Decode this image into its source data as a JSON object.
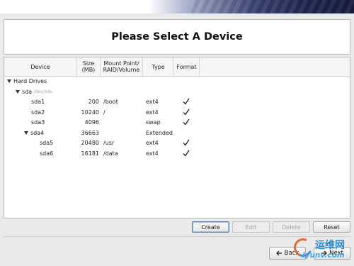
{
  "page": {
    "title": "Please Select A Device"
  },
  "table": {
    "columns": [
      {
        "key": "device",
        "label": "Device"
      },
      {
        "key": "size",
        "label": "Size (MB)"
      },
      {
        "key": "mount",
        "label": "Mount Point/ RAID/Volume"
      },
      {
        "key": "type",
        "label": "Type"
      },
      {
        "key": "format",
        "label": "Format"
      }
    ],
    "rows": [
      {
        "level": 0,
        "expander": true,
        "device": "Hard Drives",
        "path": "",
        "size": "",
        "mount": "",
        "type": "",
        "format": false
      },
      {
        "level": 1,
        "expander": true,
        "device": "sda",
        "path": "/dev/sda",
        "size": "",
        "mount": "",
        "type": "",
        "format": false
      },
      {
        "level": 2,
        "expander": false,
        "device": "sda1",
        "path": "",
        "size": "200",
        "mount": "/boot",
        "type": "ext4",
        "format": true
      },
      {
        "level": 2,
        "expander": false,
        "device": "sda2",
        "path": "",
        "size": "10240",
        "mount": "/",
        "type": "ext4",
        "format": true
      },
      {
        "level": 2,
        "expander": false,
        "device": "sda3",
        "path": "",
        "size": "4096",
        "mount": "",
        "type": "swap",
        "format": true
      },
      {
        "level": 2,
        "expander": true,
        "device": "sda4",
        "path": "",
        "size": "36663",
        "mount": "",
        "type": "Extended",
        "format": false
      },
      {
        "level": 3,
        "expander": false,
        "device": "sda5",
        "path": "",
        "size": "20480",
        "mount": "/usr",
        "type": "ext4",
        "format": true
      },
      {
        "level": 3,
        "expander": false,
        "device": "sda6",
        "path": "",
        "size": "16181",
        "mount": "/data",
        "type": "ext4",
        "format": true
      }
    ]
  },
  "buttons": {
    "create": "Create",
    "edit": "Edit",
    "delete": "Delete",
    "reset": "Reset",
    "back": "Back",
    "next": "Next"
  },
  "watermark": {
    "name": "运维网",
    "url": "iyunv.com"
  },
  "colors": {
    "banner_dark": "#20264f",
    "focus_border": "#5a83b8",
    "watermark_blue": "#2a8bd0",
    "watermark_orange": "#e0683a"
  },
  "icons": {
    "expander": "triangle-down-icon",
    "format": "checkmark-icon",
    "back": "arrow-left-icon",
    "next": "arrow-right-icon"
  }
}
